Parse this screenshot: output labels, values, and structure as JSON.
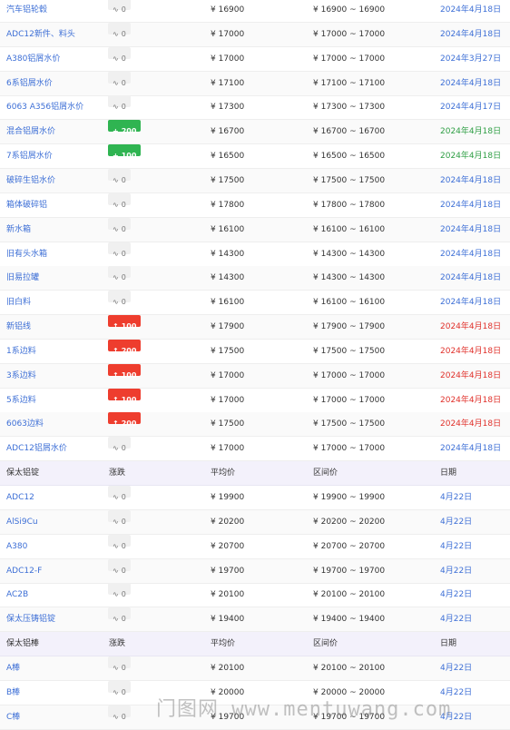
{
  "section_a_rows": [
    {
      "name": "汽车铝轮毂",
      "change": "0",
      "trend": "flat",
      "avg": "¥ 16900",
      "range": "¥ 16900 ~ 16900",
      "date": "2024年4月18日",
      "date_color": "blue"
    },
    {
      "name": "ADC12新件、料头",
      "change": "0",
      "trend": "flat",
      "avg": "¥ 17000",
      "range": "¥ 17000 ~ 17000",
      "date": "2024年4月18日",
      "date_color": "blue"
    },
    {
      "name": "A380铝屑水价",
      "change": "0",
      "trend": "flat",
      "avg": "¥ 17000",
      "range": "¥ 17000 ~ 17000",
      "date": "2024年3月27日",
      "date_color": "blue"
    },
    {
      "name": "6系铝屑水价",
      "change": "0",
      "trend": "flat",
      "avg": "¥ 17100",
      "range": "¥ 17100 ~ 17100",
      "date": "2024年4月18日",
      "date_color": "blue"
    },
    {
      "name": "6063 A356铝屑水价",
      "change": "0",
      "trend": "flat",
      "avg": "¥ 17300",
      "range": "¥ 17300 ~ 17300",
      "date": "2024年4月17日",
      "date_color": "blue"
    },
    {
      "name": "混合铝屑水价",
      "change": "200",
      "trend": "down",
      "avg": "¥ 16700",
      "range": "¥ 16700 ~ 16700",
      "date": "2024年4月18日",
      "date_color": "green"
    },
    {
      "name": "7系铝屑水价",
      "change": "100",
      "trend": "down",
      "avg": "¥ 16500",
      "range": "¥ 16500 ~ 16500",
      "date": "2024年4月18日",
      "date_color": "green"
    },
    {
      "name": "破碎生铝水价",
      "change": "0",
      "trend": "flat",
      "avg": "¥ 17500",
      "range": "¥ 17500 ~ 17500",
      "date": "2024年4月18日",
      "date_color": "blue"
    },
    {
      "name": "箱体破碎铝",
      "change": "0",
      "trend": "flat",
      "avg": "¥ 17800",
      "range": "¥ 17800 ~ 17800",
      "date": "2024年4月18日",
      "date_color": "blue"
    },
    {
      "name": "新水箱",
      "change": "0",
      "trend": "flat",
      "avg": "¥ 16100",
      "range": "¥ 16100 ~ 16100",
      "date": "2024年4月18日",
      "date_color": "blue"
    },
    {
      "name": "旧有头水箱",
      "change": "0",
      "trend": "flat",
      "avg": "¥ 14300",
      "range": "¥ 14300 ~ 14300",
      "date": "2024年4月18日",
      "date_color": "blue"
    },
    {
      "name": "旧易拉罐",
      "change": "0",
      "trend": "flat",
      "avg": "¥ 14300",
      "range": "¥ 14300 ~ 14300",
      "date": "2024年4月18日",
      "date_color": "blue"
    },
    {
      "name": "旧白料",
      "change": "0",
      "trend": "flat",
      "avg": "¥ 16100",
      "range": "¥ 16100 ~ 16100",
      "date": "2024年4月18日",
      "date_color": "blue"
    },
    {
      "name": "新铝线",
      "change": "100",
      "trend": "up",
      "avg": "¥ 17900",
      "range": "¥ 17900 ~ 17900",
      "date": "2024年4月18日",
      "date_color": "red"
    },
    {
      "name": "1系边料",
      "change": "200",
      "trend": "up",
      "avg": "¥ 17500",
      "range": "¥ 17500 ~ 17500",
      "date": "2024年4月18日",
      "date_color": "red"
    },
    {
      "name": "3系边料",
      "change": "100",
      "trend": "up",
      "avg": "¥ 17000",
      "range": "¥ 17000 ~ 17000",
      "date": "2024年4月18日",
      "date_color": "red"
    },
    {
      "name": "5系边料",
      "change": "100",
      "trend": "up",
      "avg": "¥ 17000",
      "range": "¥ 17000 ~ 17000",
      "date": "2024年4月18日",
      "date_color": "red"
    },
    {
      "name": "6063边料",
      "change": "200",
      "trend": "up",
      "avg": "¥ 17500",
      "range": "¥ 17500 ~ 17500",
      "date": "2024年4月18日",
      "date_color": "red"
    },
    {
      "name": "ADC12铝屑水价",
      "change": "0",
      "trend": "flat",
      "avg": "¥ 17000",
      "range": "¥ 17000 ~ 17000",
      "date": "2024年4月18日",
      "date_color": "blue"
    }
  ],
  "section_b": {
    "header": {
      "name": "保太铝锭",
      "change": "涨跌",
      "avg": "平均价",
      "range": "区间价",
      "date": "日期"
    },
    "rows": [
      {
        "name": "ADC12",
        "change": "0",
        "trend": "flat",
        "avg": "¥ 19900",
        "range": "¥ 19900 ~ 19900",
        "date": "4月22日",
        "date_color": "blue"
      },
      {
        "name": "AlSi9Cu",
        "change": "0",
        "trend": "flat",
        "avg": "¥ 20200",
        "range": "¥ 20200 ~ 20200",
        "date": "4月22日",
        "date_color": "blue"
      },
      {
        "name": "A380",
        "change": "0",
        "trend": "flat",
        "avg": "¥ 20700",
        "range": "¥ 20700 ~ 20700",
        "date": "4月22日",
        "date_color": "blue"
      },
      {
        "name": "ADC12-F",
        "change": "0",
        "trend": "flat",
        "avg": "¥ 19700",
        "range": "¥ 19700 ~ 19700",
        "date": "4月22日",
        "date_color": "blue"
      },
      {
        "name": "AC2B",
        "change": "0",
        "trend": "flat",
        "avg": "¥ 20100",
        "range": "¥ 20100 ~ 20100",
        "date": "4月22日",
        "date_color": "blue"
      },
      {
        "name": "保太压铸铝锭",
        "change": "0",
        "trend": "flat",
        "avg": "¥ 19400",
        "range": "¥ 19400 ~ 19400",
        "date": "4月22日",
        "date_color": "blue"
      }
    ]
  },
  "section_c": {
    "header": {
      "name": "保太铝棒",
      "change": "涨跌",
      "avg": "平均价",
      "range": "区间价",
      "date": "日期"
    },
    "rows": [
      {
        "name": "A棒",
        "change": "0",
        "trend": "flat",
        "avg": "¥ 20100",
        "range": "¥ 20100 ~ 20100",
        "date": "4月22日",
        "date_color": "blue"
      },
      {
        "name": "B棒",
        "change": "0",
        "trend": "flat",
        "avg": "¥ 20000",
        "range": "¥ 20000 ~ 20000",
        "date": "4月22日",
        "date_color": "blue"
      },
      {
        "name": "C棒",
        "change": "0",
        "trend": "flat",
        "avg": "¥ 19700",
        "range": "¥ 19700 ~ 19700",
        "date": "4月22日",
        "date_color": "blue"
      }
    ]
  },
  "icons": {
    "flat": "∿",
    "up": "↑",
    "down": "+"
  },
  "trend_colors": {
    "up": "#ee3d2e",
    "down": "#2fb451",
    "flat": "#f0f0f0"
  },
  "watermark": "门图网 www.mentuwang.com"
}
